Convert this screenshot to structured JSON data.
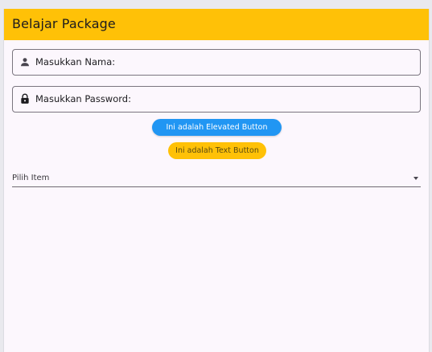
{
  "appbar": {
    "title": "Belajar Package",
    "background": "#ffc107"
  },
  "form": {
    "name_field": {
      "label": "Masukkan Nama:",
      "icon": "person-icon"
    },
    "password_field": {
      "label": "Masukkan Password:",
      "icon": "lock-icon"
    }
  },
  "buttons": {
    "elevated_label": "Ini adalah Elevated Button",
    "elevated_color": "#2196f3",
    "text_label": "Ini adalah Text Button",
    "text_color": "#ffc107"
  },
  "dropdown": {
    "selected": "Pilih Item",
    "icon": "arrow-drop-down-icon"
  }
}
